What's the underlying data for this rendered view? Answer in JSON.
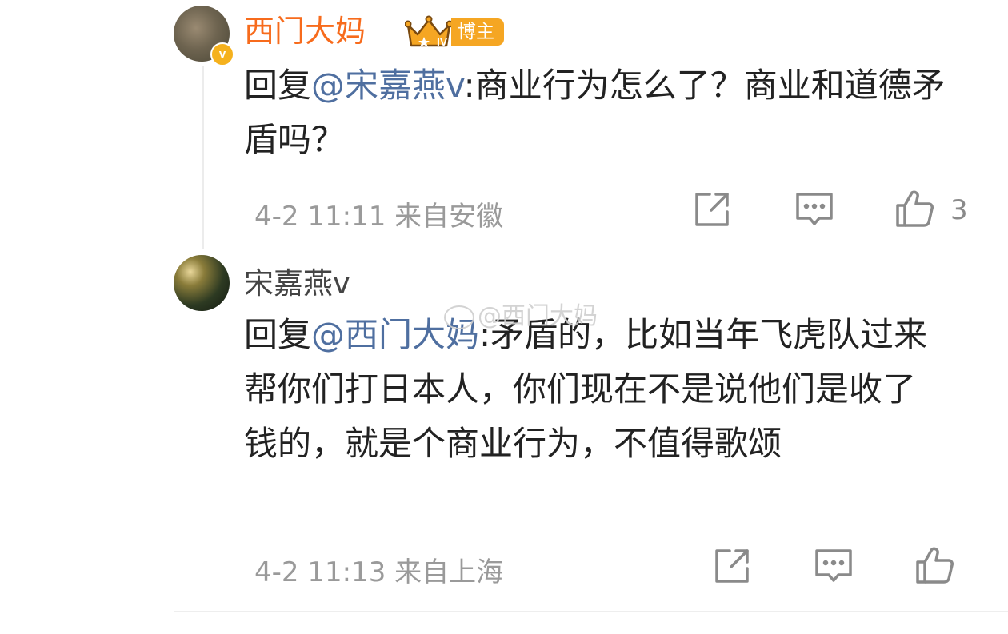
{
  "comments": [
    {
      "username": "西门大妈",
      "badge_label": "博主",
      "reply_prefix": "回复",
      "mention": "@宋嘉燕v",
      "text": ":商业行为怎么了？商业和道德矛盾吗？",
      "time": "4-2 11:11",
      "location": "来自安徽",
      "like_count": "3"
    },
    {
      "username": "宋嘉燕v",
      "reply_prefix": "回复",
      "mention": "@西门大妈",
      "text": ":矛盾的，比如当年飞虎队过来帮你们打日本人，你们现在不是说他们是收了钱的，就是个商业行为，不值得歌颂",
      "time": "4-2 11:13",
      "location": "来自上海"
    }
  ],
  "watermark": "@西门大妈",
  "colors": {
    "username_highlight": "#f76b1c",
    "mention": "#4f6fa0",
    "meta": "#9a9a9a",
    "badge": "#f5a623"
  },
  "icons": {
    "verified": "verified-v-badge",
    "share": "share-icon",
    "comment": "comment-icon",
    "like": "thumbs-up-icon"
  }
}
